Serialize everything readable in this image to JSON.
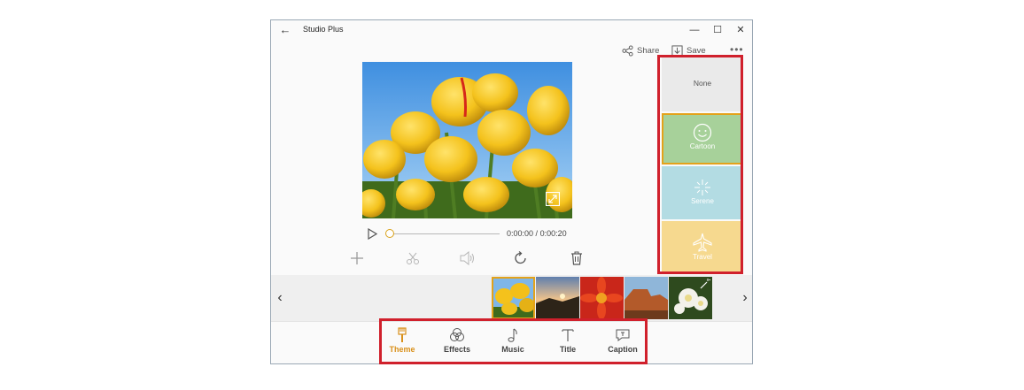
{
  "window": {
    "title": "Studio Plus",
    "back_glyph": "←",
    "minimize_glyph": "—",
    "maximize_glyph": "☐",
    "close_glyph": "✕"
  },
  "toolbar": {
    "share_label": "Share",
    "save_label": "Save",
    "more_glyph": "•••"
  },
  "player": {
    "current_time": "0:00:00",
    "separator": "/",
    "total_time": "0:00:20",
    "progress": 0
  },
  "icons": {
    "back": "back-arrow-icon",
    "share": "share-icon",
    "save": "save-download-icon",
    "more": "more-ellipsis-icon",
    "expand": "expand-icon",
    "play": "play-icon",
    "add": "add-plus-icon",
    "trim": "scissors-icon",
    "volume": "speaker-icon",
    "rotate": "rotate-icon",
    "delete": "trash-icon"
  },
  "filmstrip": {
    "left_glyph": "‹",
    "right_glyph": "›",
    "selected_index": 0,
    "clips": [
      "yellow-tulips",
      "sunset-landscape",
      "red-flower",
      "red-canyon",
      "white-flowers"
    ]
  },
  "tabs": [
    {
      "label": "Theme",
      "icon": "brush-icon",
      "active": true
    },
    {
      "label": "Effects",
      "icon": "effects-circles-icon",
      "active": false
    },
    {
      "label": "Music",
      "icon": "music-note-icon",
      "active": false
    },
    {
      "label": "Title",
      "icon": "text-t-icon",
      "active": false
    },
    {
      "label": "Caption",
      "icon": "caption-bubble-icon",
      "active": false
    }
  ],
  "themes": [
    {
      "label": "None",
      "color": "#eaeaea",
      "selected": false
    },
    {
      "label": "Cartoon",
      "icon": "smiley-icon",
      "color": "#a7d19a",
      "selected": true
    },
    {
      "label": "Serene",
      "icon": "sparkle-icon",
      "color": "#b3dce3",
      "selected": false
    },
    {
      "label": "Travel",
      "icon": "airplane-icon",
      "color": "#f6d98f",
      "selected": false
    }
  ],
  "colors": {
    "accent": "#d9901a",
    "highlight_box": "#d0202c"
  }
}
